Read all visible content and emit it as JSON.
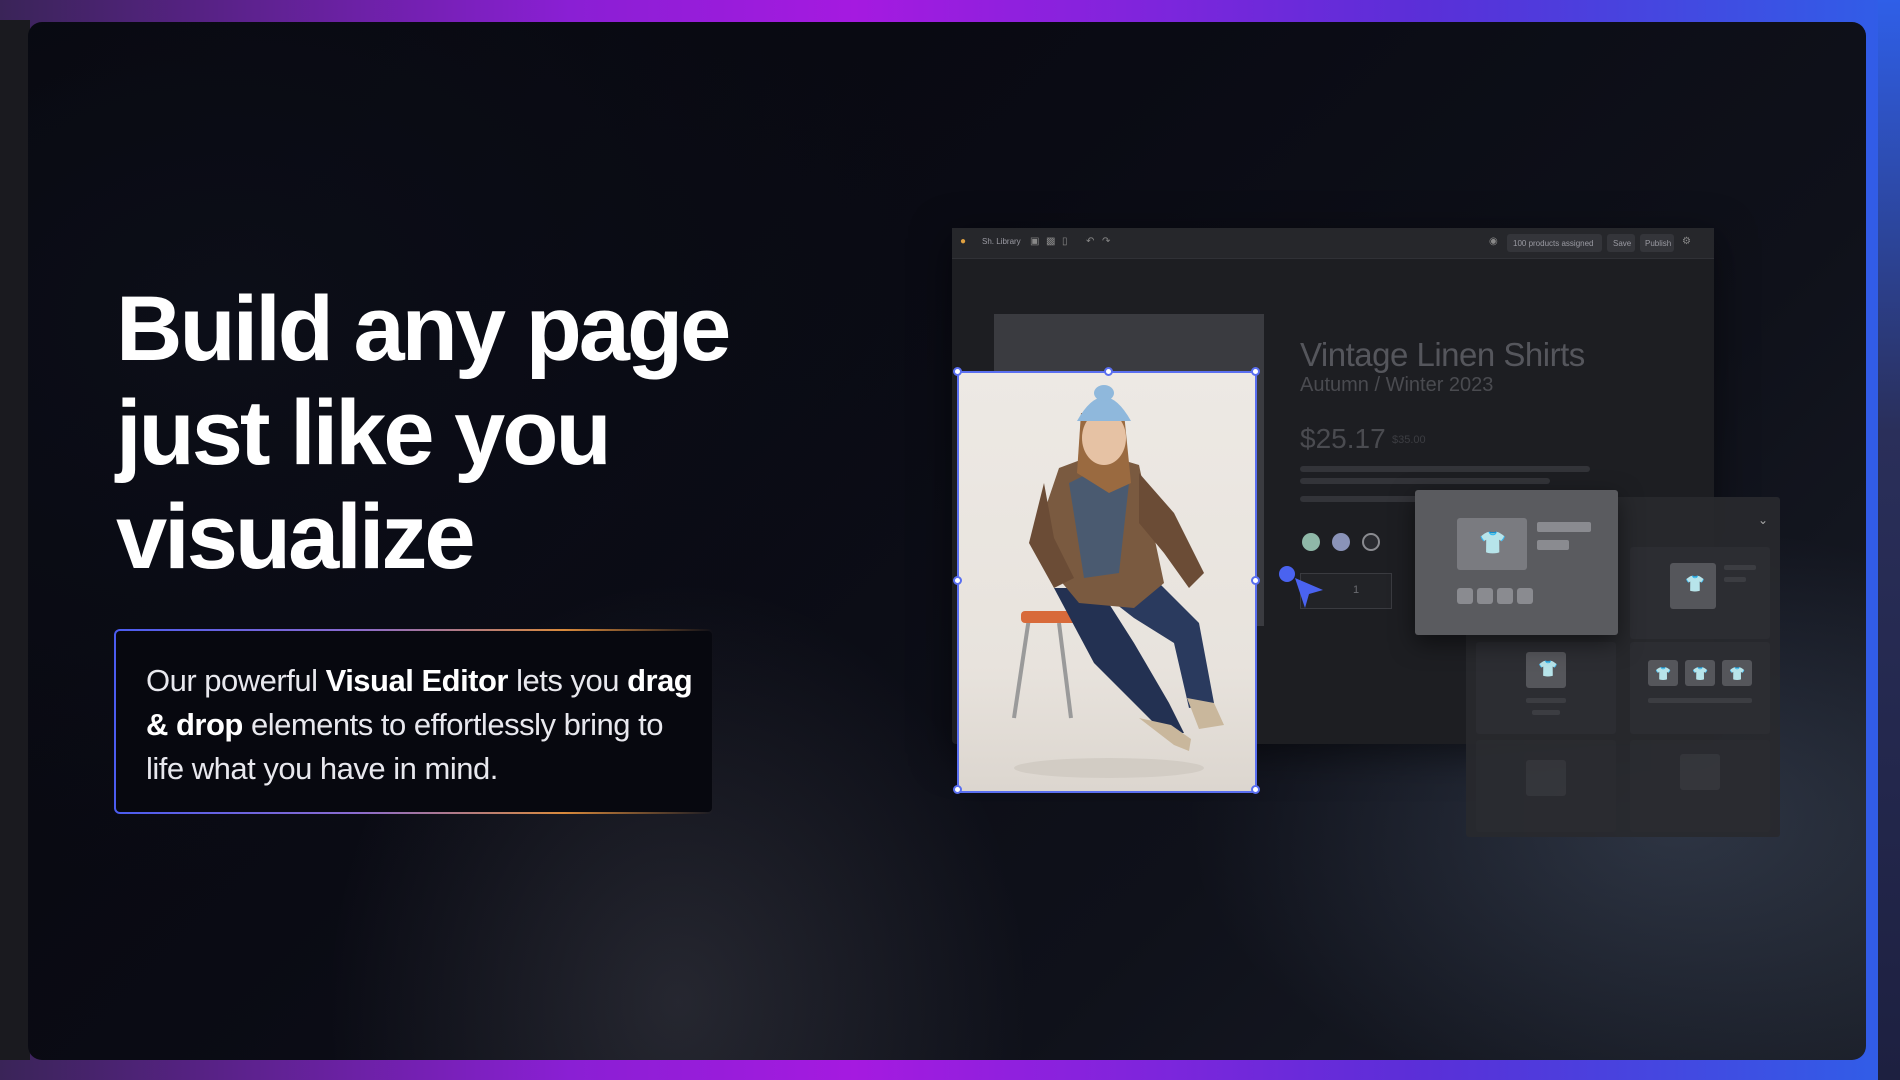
{
  "headline": {
    "line1": "Build any page",
    "line2": "just like you",
    "line3": "visualize"
  },
  "description": {
    "part1": "Our powerful ",
    "bold1": "Visual Editor",
    "part2": " lets you ",
    "bold2": "drag & drop",
    "part3": " elements to effortlessly bring to life what you have in mind."
  },
  "editor": {
    "toolbar": {
      "library_label": "Sh. Library",
      "products_assigned": "100 products assigned",
      "save_label": "Save",
      "publish_label": "Publish"
    },
    "product": {
      "title": "Vintage Linen Shirts",
      "subtitle": "Autumn / Winter 2023",
      "price": "$25.17",
      "old_price": "$35.00",
      "quantity": "1",
      "qty_minus": "-"
    },
    "swatch_colors": [
      "#8fb8a8",
      "#8a93b8",
      "#2a2b30"
    ]
  },
  "widget_panel": {
    "chevron_icon": "chevron-down-icon",
    "tee_icon": "tshirt-icon"
  },
  "colors": {
    "accent_blue": "#5a6ff0",
    "frame_purple": "#a51ae0",
    "frame_blue": "#2f5fe8"
  }
}
